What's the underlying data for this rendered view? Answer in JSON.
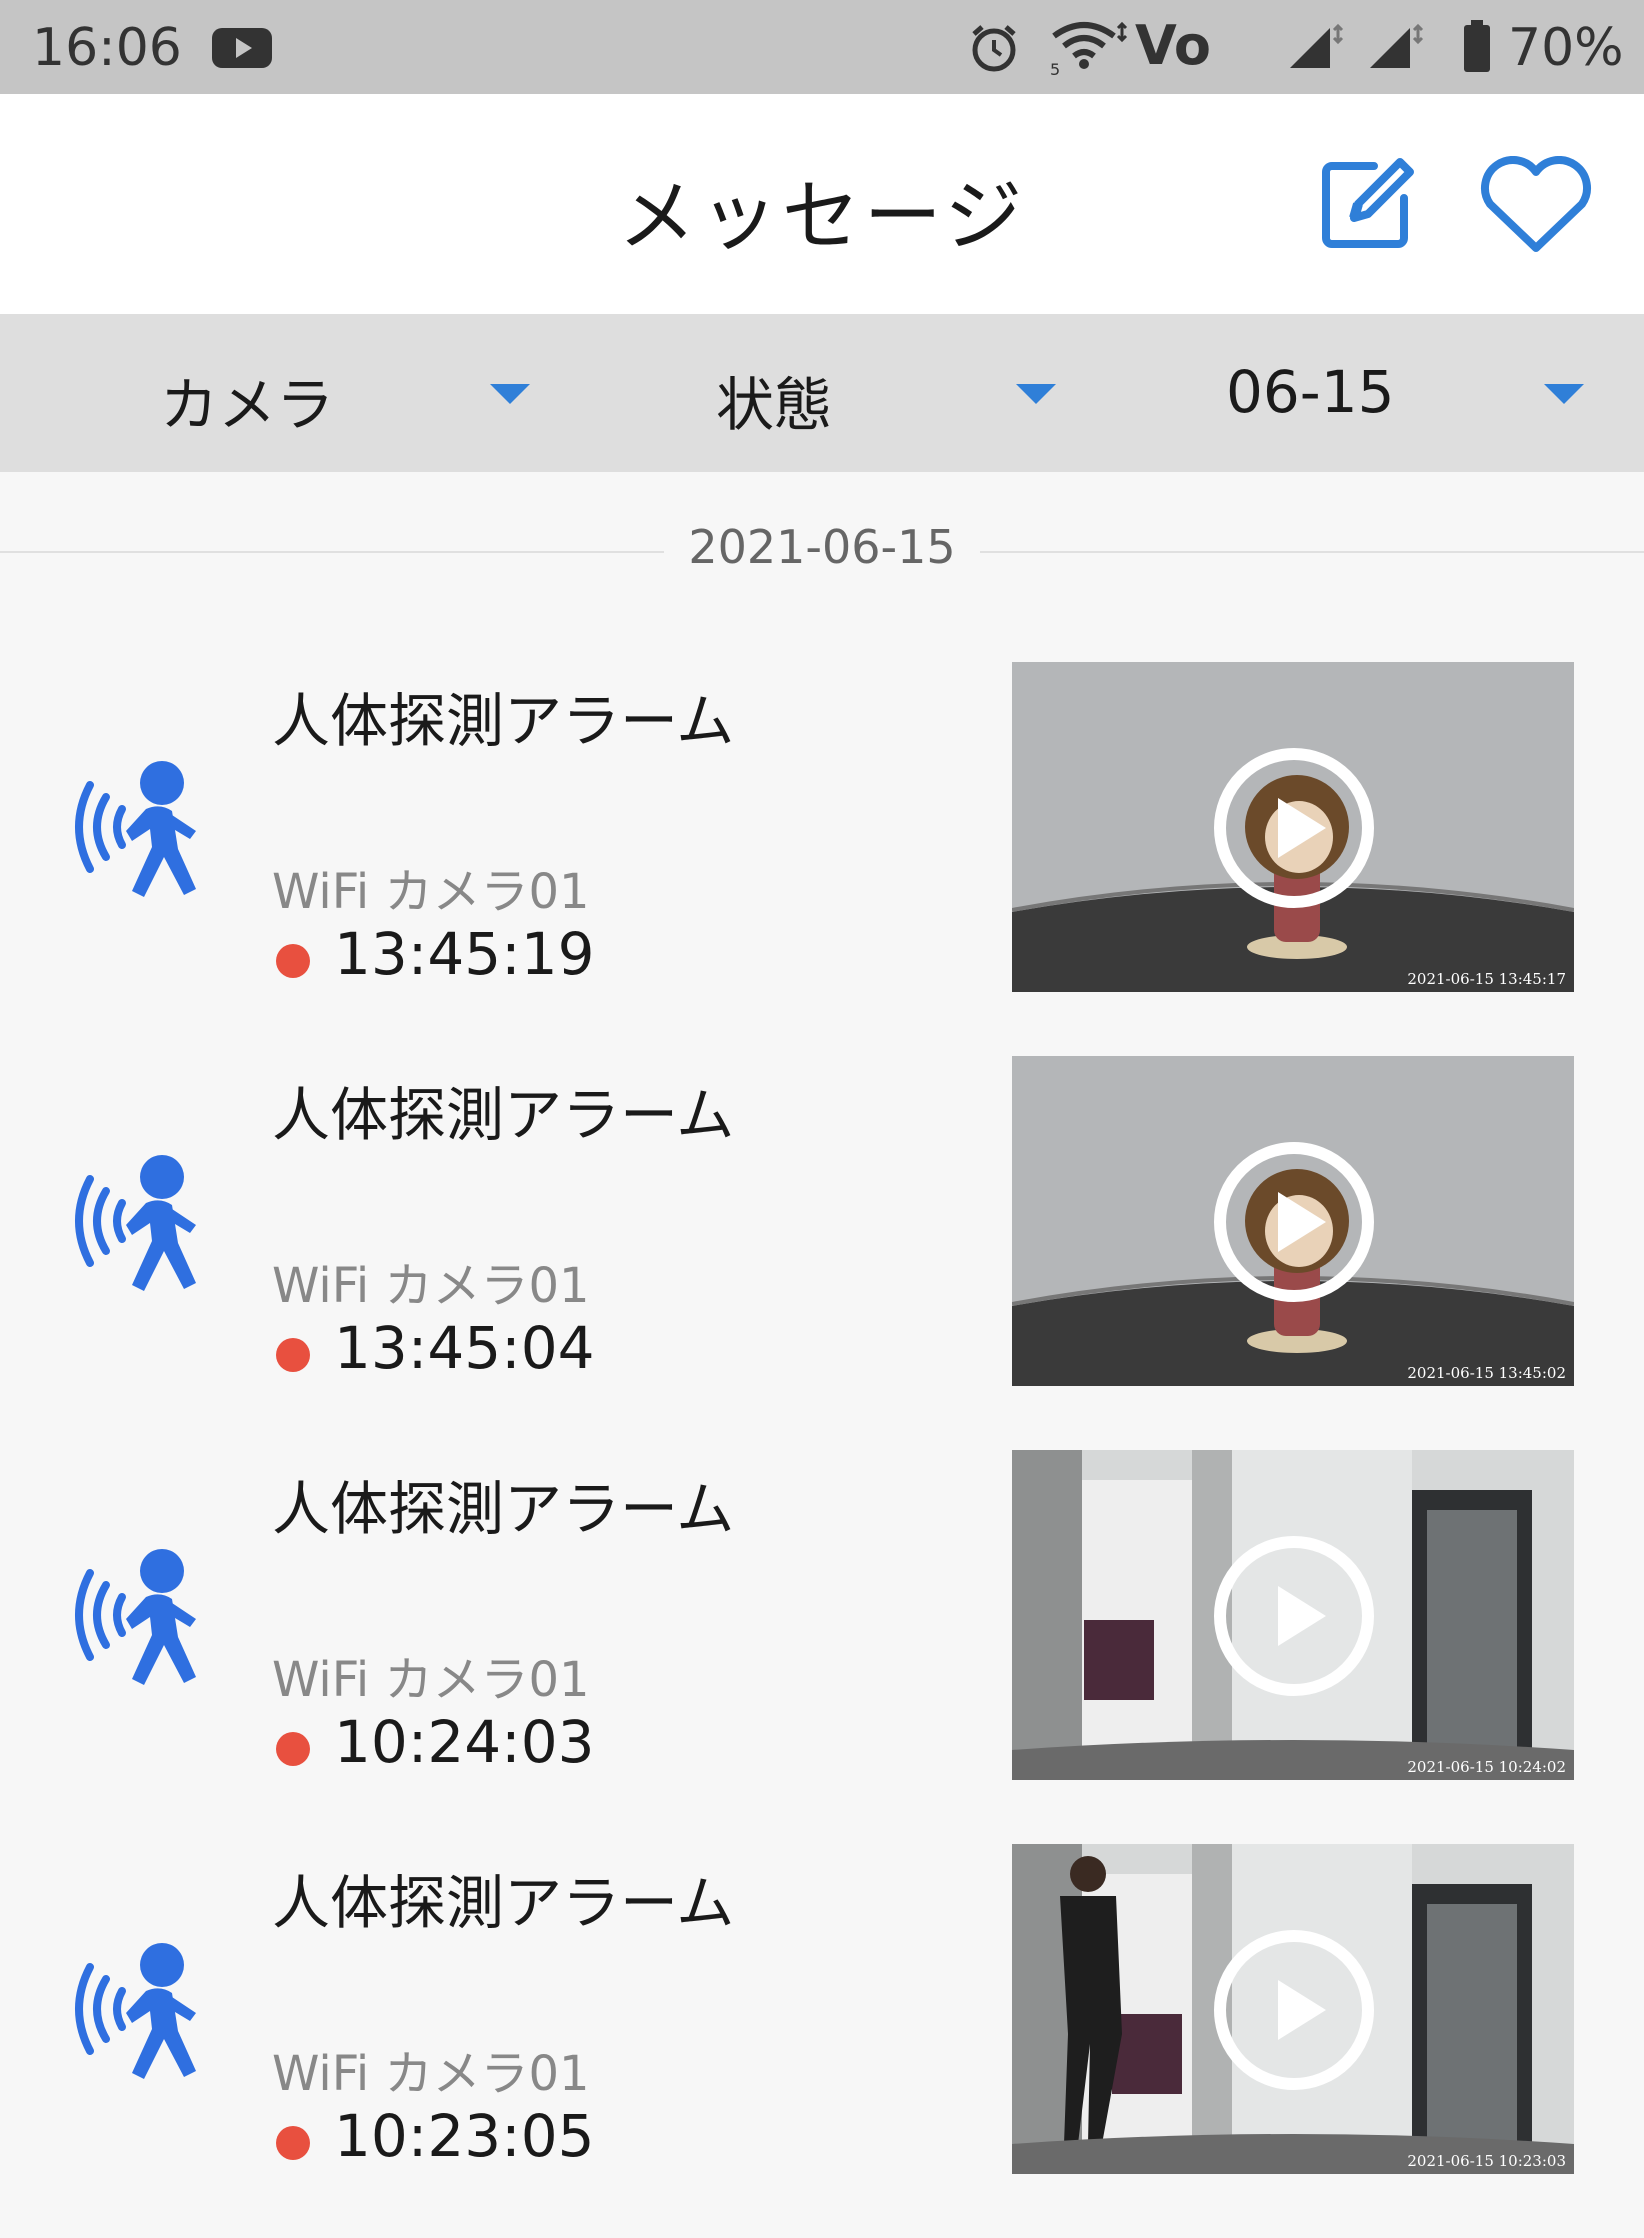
{
  "status_bar": {
    "time": "16:06",
    "battery": "70%",
    "volte": "Vo",
    "icons": [
      "youtube-icon",
      "alarm-clock-icon",
      "wifi-icon",
      "volte-icon",
      "signal-icon",
      "signal-icon",
      "battery-icon"
    ]
  },
  "header": {
    "title": "メッセージ",
    "edit_icon": "edit-icon",
    "favorite_icon": "heart-icon",
    "accent": "#2f7fd8"
  },
  "filters": [
    {
      "label": "カメラ"
    },
    {
      "label": "状態"
    },
    {
      "label": "06-15"
    }
  ],
  "date_group": "2021-06-15",
  "alarms": [
    {
      "title": "人体探測アラーム",
      "camera": "WiFi カメラ01",
      "time": "13:45:19",
      "thumb_timestamp": "2021-06-15 13:45:17",
      "scene": "figure"
    },
    {
      "title": "人体探測アラーム",
      "camera": "WiFi カメラ01",
      "time": "13:45:04",
      "thumb_timestamp": "2021-06-15 13:45:02",
      "scene": "figure"
    },
    {
      "title": "人体探測アラーム",
      "camera": "WiFi カメラ01",
      "time": "10:24:03",
      "thumb_timestamp": "2021-06-15 10:24:02",
      "scene": "room"
    },
    {
      "title": "人体探測アラーム",
      "camera": "WiFi カメラ01",
      "time": "10:23:05",
      "thumb_timestamp": "2021-06-15 10:23:03",
      "scene": "room-person"
    }
  ],
  "colors": {
    "alarm_icon": "#2f6fe0",
    "status_dot": "#e8503f"
  }
}
